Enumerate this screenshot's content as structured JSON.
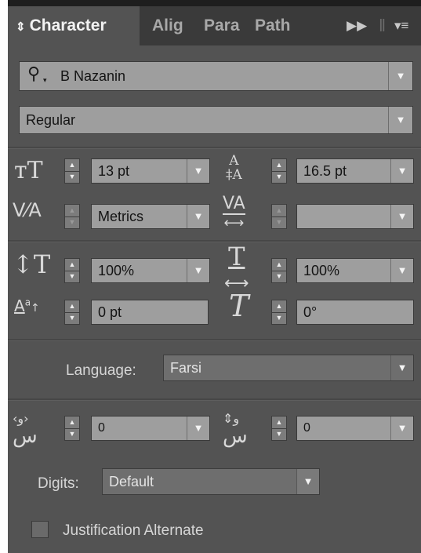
{
  "tabs": [
    {
      "label": "Character",
      "active": true
    },
    {
      "label": "Alig",
      "active": false
    },
    {
      "label": "Para",
      "active": false
    },
    {
      "label": "Path",
      "active": false
    }
  ],
  "tab_controls": {
    "expand": "»",
    "menu": "▾≡"
  },
  "font": {
    "family": "B Nazanin",
    "style": "Regular"
  },
  "size": {
    "font_size": "13 pt",
    "leading": "16.5 pt"
  },
  "kerning": {
    "value": "Metrics",
    "tracking": ""
  },
  "scale": {
    "vertical": "100%",
    "horizontal": "100%"
  },
  "baseline_shift": "0 pt",
  "rotation": "0°",
  "language": {
    "label": "Language:",
    "value": "Farsi"
  },
  "arabic": {
    "kashida": "0",
    "diacritic_vertical": "0"
  },
  "digits": {
    "label": "Digits:",
    "value": "Default"
  },
  "justification": {
    "label": "Justification Alternate",
    "checked": false
  },
  "colors": {
    "panel": "#535353",
    "tabbar": "#3a3a3a",
    "field": "#9e9e9e"
  }
}
